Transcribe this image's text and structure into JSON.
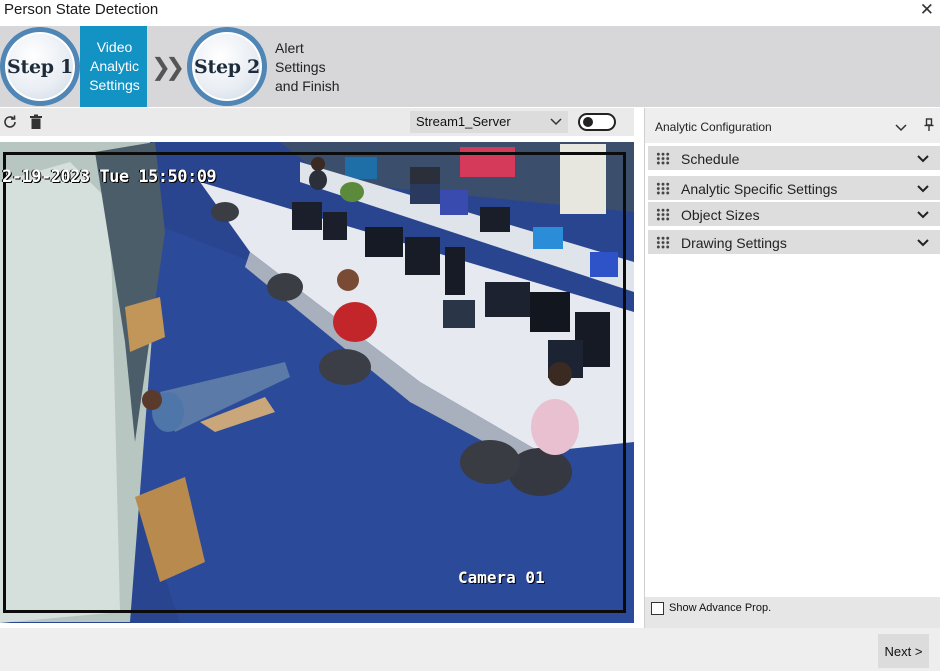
{
  "window": {
    "title": "Person State Detection"
  },
  "steps": [
    {
      "badge": "Step 1",
      "label": "Video Analytic Settings"
    },
    {
      "badge": "Step 2",
      "label": "Alert Settings and Finish"
    }
  ],
  "stream": {
    "selected": "Stream1_Server"
  },
  "video": {
    "timestamp": "2-19-2023 Tue 15:50:09",
    "camera_label": "Camera 01"
  },
  "config_panel": {
    "title": "Analytic Configuration",
    "sections": [
      {
        "label": "Schedule"
      },
      {
        "label": "Analytic Specific Settings"
      },
      {
        "label": "Object Sizes"
      },
      {
        "label": "Drawing Settings"
      }
    ],
    "show_advance_label": "Show Advance Prop."
  },
  "footer": {
    "next_label": "Next >"
  },
  "colors": {
    "active_step": "#1392c4",
    "badge_ring": "#4f86b5",
    "floor": "#233b7a"
  }
}
